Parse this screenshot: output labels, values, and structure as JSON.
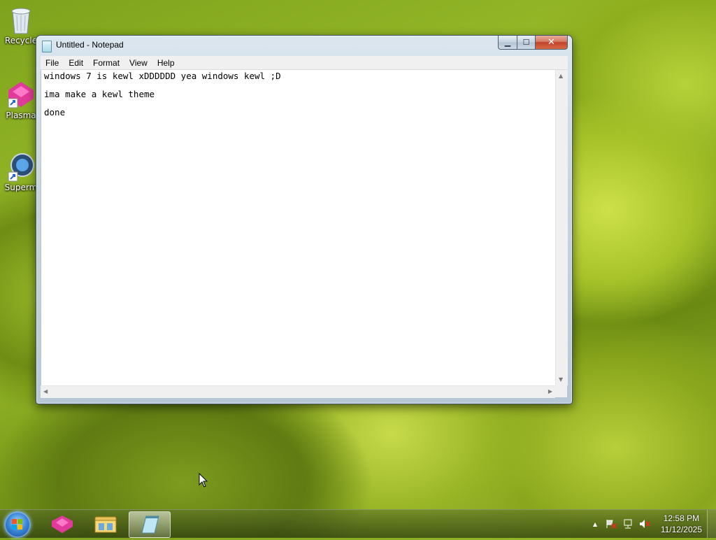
{
  "desktop": {
    "icons": [
      {
        "label": "Recycle"
      },
      {
        "label": "Plasma"
      },
      {
        "label": "Superm"
      }
    ]
  },
  "window": {
    "title": "Untitled - Notepad",
    "controls": {
      "minimize": "▁",
      "maximize": "☐",
      "close": "✕"
    },
    "menu": [
      "File",
      "Edit",
      "Format",
      "View",
      "Help"
    ],
    "lines": [
      "windows 7 is kewl xDDDDDD yea windows kewl ;D",
      "ima make a kewl theme",
      "done"
    ]
  },
  "taskbar": {
    "clock_time": "12:58 PM",
    "clock_date": "11/12/2025",
    "tray_overflow": "▲"
  },
  "colors": {
    "titlebar_glass": "#c7d5e1",
    "close_red": "#c2432b",
    "taskbar": "#4a5f1a"
  }
}
